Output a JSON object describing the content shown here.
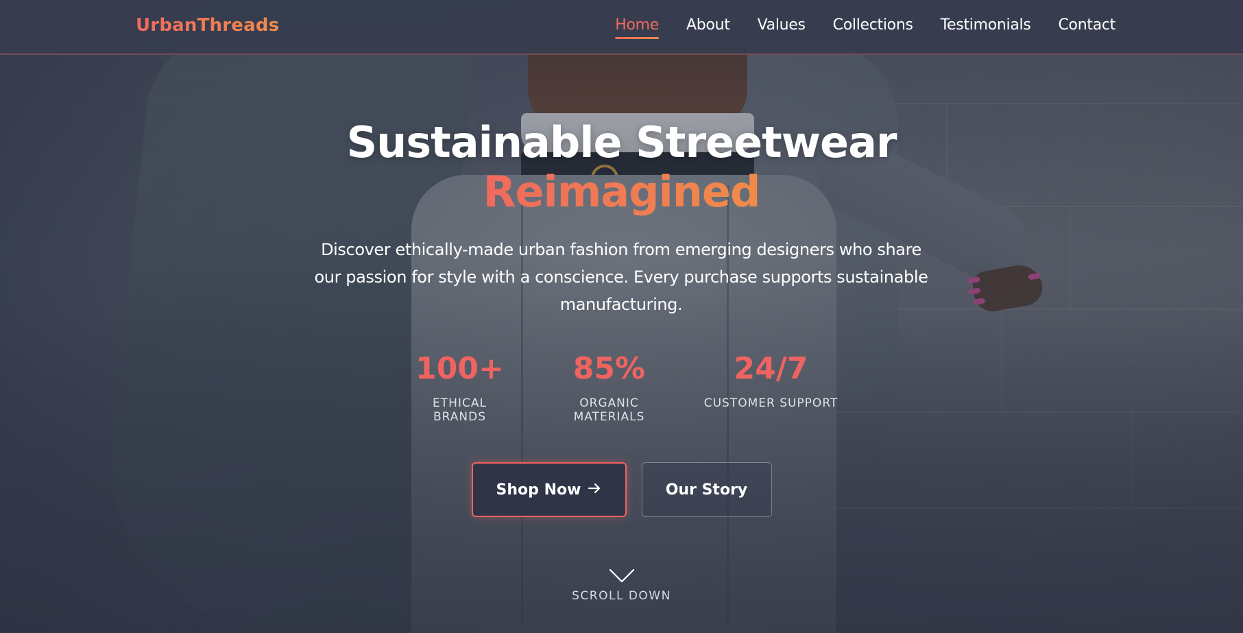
{
  "brand": {
    "logo_text": "UrbanThreads"
  },
  "nav": {
    "items": [
      {
        "label": "Home",
        "active": true
      },
      {
        "label": "About",
        "active": false
      },
      {
        "label": "Values",
        "active": false
      },
      {
        "label": "Collections",
        "active": false
      },
      {
        "label": "Testimonials",
        "active": false
      },
      {
        "label": "Contact",
        "active": false
      }
    ]
  },
  "hero": {
    "title": "Sustainable Streetwear",
    "title_accent": "Reimagined",
    "description": "Discover ethically-made urban fashion from emerging designers who share our passion for style with a conscience. Every purchase supports sustainable manufacturing.",
    "stats": [
      {
        "value": "100+",
        "label": "ETHICAL BRANDS"
      },
      {
        "value": "85%",
        "label": "ORGANIC MATERIALS"
      },
      {
        "value": "24/7",
        "label": "CUSTOMER SUPPORT"
      }
    ],
    "primary_button": {
      "label": "Shop Now",
      "icon": "arrow-right-icon"
    },
    "secondary_button": {
      "label": "Our Story"
    },
    "scroll": {
      "label": "SCROLL DOWN",
      "icon": "chevron-down-icon"
    }
  },
  "colors": {
    "accent": "#ef6360",
    "accent_gradient_end": "#f08c4a",
    "navbar_bg": "#363d4e",
    "button_bg": "#2f3547",
    "text": "#ffffff"
  }
}
